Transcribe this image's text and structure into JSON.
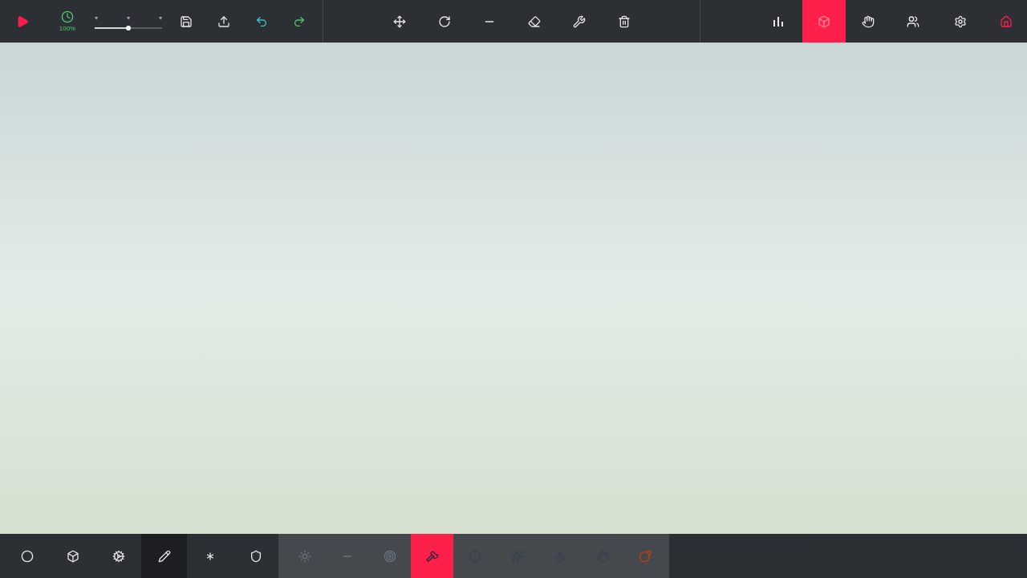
{
  "top_bar": {
    "simulate": {
      "selected": false
    },
    "time_scale": {
      "reading": "100%",
      "level": 0.5
    },
    "file_tools": [
      {
        "selected": false
      },
      {
        "selected": false
      },
      {
        "selected": false
      },
      {
        "selected": false
      }
    ],
    "build_tools": [
      {
        "selected": false
      },
      {
        "selected": false
      },
      {
        "selected": false
      },
      {
        "selected": false
      },
      {
        "selected": false
      },
      {
        "selected": false
      }
    ],
    "view_tools": [
      {
        "selected": false
      },
      {
        "selected": true
      },
      {
        "selected": false
      },
      {
        "selected": false
      },
      {
        "selected": false
      },
      {
        "selected": false
      }
    ]
  },
  "bottom_bar": {
    "categories": [
      {
        "selected": false
      },
      {
        "selected": false
      },
      {
        "selected": false
      },
      {
        "selected": true
      },
      {
        "selected": false
      },
      {
        "selected": false
      }
    ],
    "blocks": [
      {
        "selected": false
      },
      {
        "selected": false
      },
      {
        "selected": false
      },
      {
        "selected": true
      },
      {
        "selected": false
      },
      {
        "selected": false
      },
      {
        "selected": false
      },
      {
        "selected": false
      },
      {
        "selected": false
      }
    ]
  }
}
